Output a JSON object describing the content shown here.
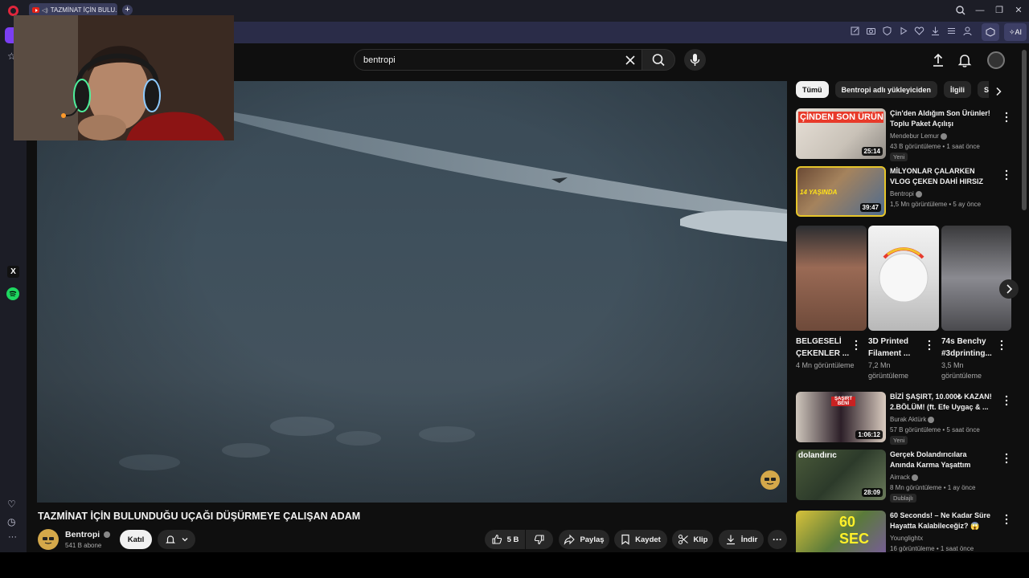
{
  "browser": {
    "tab_title": "TAZMİNAT İÇİN BULU..."
  },
  "search": {
    "query": "bentropi"
  },
  "video": {
    "title": "TAZMİNAT İÇİN BULUNDUĞU UÇAĞI DÜŞÜRMEYE ÇALIŞAN ADAM",
    "channel": "Bentropi",
    "subscribers": "541 B abone",
    "join_label": "Katıl",
    "likes": "5 B",
    "share_label": "Paylaş",
    "save_label": "Kaydet",
    "clip_label": "Klip",
    "download_label": "İndir"
  },
  "chips": [
    "Tümü",
    "Bentropi adlı yükleyiciden",
    "İlgili",
    "Sa"
  ],
  "recommendations": [
    {
      "title": "Çin'den Aldığım Son Ürünler! Toplu Paket Açılışı",
      "channel": "Mendebur Lemur",
      "meta": "43 B görüntüleme • 1 saat önce",
      "duration": "25:14",
      "badge": "Yeni",
      "thumb_text": "ÇİNDEN SON ÜRÜNLER"
    },
    {
      "title": "MİLYONLAR ÇALARKEN VLOG ÇEKEN DAHİ HIRSIZ",
      "channel": "Bentropi",
      "meta": "1,5 Mn görüntüleme • 5 ay önce",
      "duration": "39:47",
      "thumb_text": "14 YAŞINDA"
    },
    {
      "title": "BİZİ ŞAŞIRT, 10.000₺ KAZAN! 2.BÖLÜM! (ft. Efe Uygaç & ...",
      "channel": "Burak Aktürk",
      "meta": "57 B görüntüleme • 5 saat önce",
      "duration": "1:06:12",
      "badge": "Yeni",
      "thumb_text": "ŞAŞIRT BENİ"
    },
    {
      "title": "Gerçek Dolandırıcılara Anında Karma Yaşattım",
      "channel": "Airrack",
      "meta": "8 Mn görüntüleme • 1 ay önce",
      "duration": "28:09",
      "badge": "Dublajlı",
      "thumb_text": "dolandırıc"
    },
    {
      "title": "60 Seconds! – Ne Kadar Süre Hayatta Kalabileceğiz? 😱",
      "channel": "Younglightx",
      "meta": "16 görüntüleme • 1 saat önce",
      "thumb_text": "60 SEC"
    }
  ],
  "shorts": [
    {
      "title": "BELGESELİ ÇEKENLER ...",
      "meta": "4 Mn görüntüleme"
    },
    {
      "title": "3D Printed Filament ...",
      "meta": "7,2 Mn görüntüleme"
    },
    {
      "title": "74s Benchy #3dprinting...",
      "meta": "3,5 Mn görüntüleme"
    }
  ],
  "colors": {
    "background": "#0f0f0f",
    "browser_chrome": "#1c1d26",
    "address_bar": "#2a2c48",
    "accent": "#8a5cf6",
    "youtube_red": "#e62117"
  }
}
